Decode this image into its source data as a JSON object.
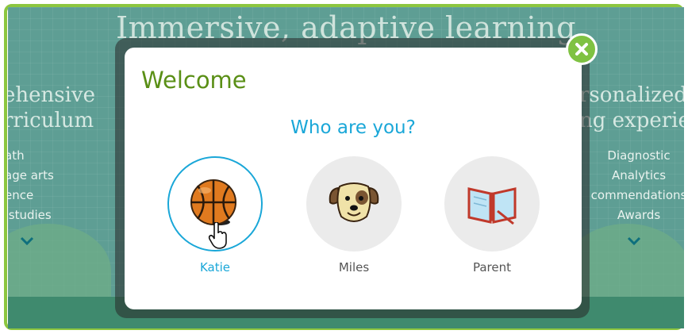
{
  "background": {
    "title": "Immersive, adaptive learning",
    "left_heading": [
      "ehensive",
      "rriculum"
    ],
    "left_items": [
      "ath",
      "age arts",
      "ence",
      " studies"
    ],
    "right_heading": [
      "rsonalized",
      "ng experie"
    ],
    "right_items": [
      "Diagnostic",
      "Analytics",
      "commendations",
      "Awards"
    ]
  },
  "modal": {
    "title": "Welcome",
    "prompt": "Who are you?",
    "profiles": [
      {
        "name": "Katie",
        "icon": "basketball-icon",
        "selected": true
      },
      {
        "name": "Miles",
        "icon": "dog-icon",
        "selected": false
      },
      {
        "name": "Parent",
        "icon": "book-icon",
        "selected": false
      }
    ],
    "close_icon": "close-icon"
  },
  "colors": {
    "frame_border": "#8cc63f",
    "welcome_text": "#5a8f16",
    "accent_blue": "#1aa7d8",
    "close_button": "#7fc242"
  }
}
